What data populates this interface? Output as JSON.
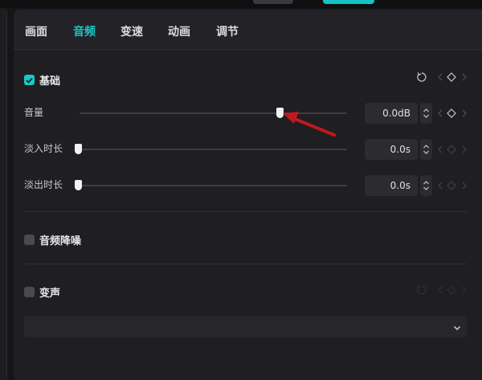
{
  "tabs": [
    {
      "label": "画面",
      "active": false
    },
    {
      "label": "音频",
      "active": true
    },
    {
      "label": "变速",
      "active": false
    },
    {
      "label": "动画",
      "active": false
    },
    {
      "label": "调节",
      "active": false
    }
  ],
  "basic": {
    "title": "基础",
    "checked": true,
    "volume": {
      "label": "音量",
      "value": "0.0dB",
      "slider_fraction": 0.7
    },
    "fade_in": {
      "label": "淡入时长",
      "value": "0.0s",
      "slider_fraction": 0.0
    },
    "fade_out": {
      "label": "淡出时长",
      "value": "0.0s",
      "slider_fraction": 0.0
    }
  },
  "noise_reduction": {
    "title": "音频降噪",
    "checked": false
  },
  "voice_change": {
    "title": "变声",
    "checked": false,
    "selected_option": ""
  },
  "colors": {
    "accent": "#19c8ca",
    "annotation_arrow": "#c0181e"
  }
}
